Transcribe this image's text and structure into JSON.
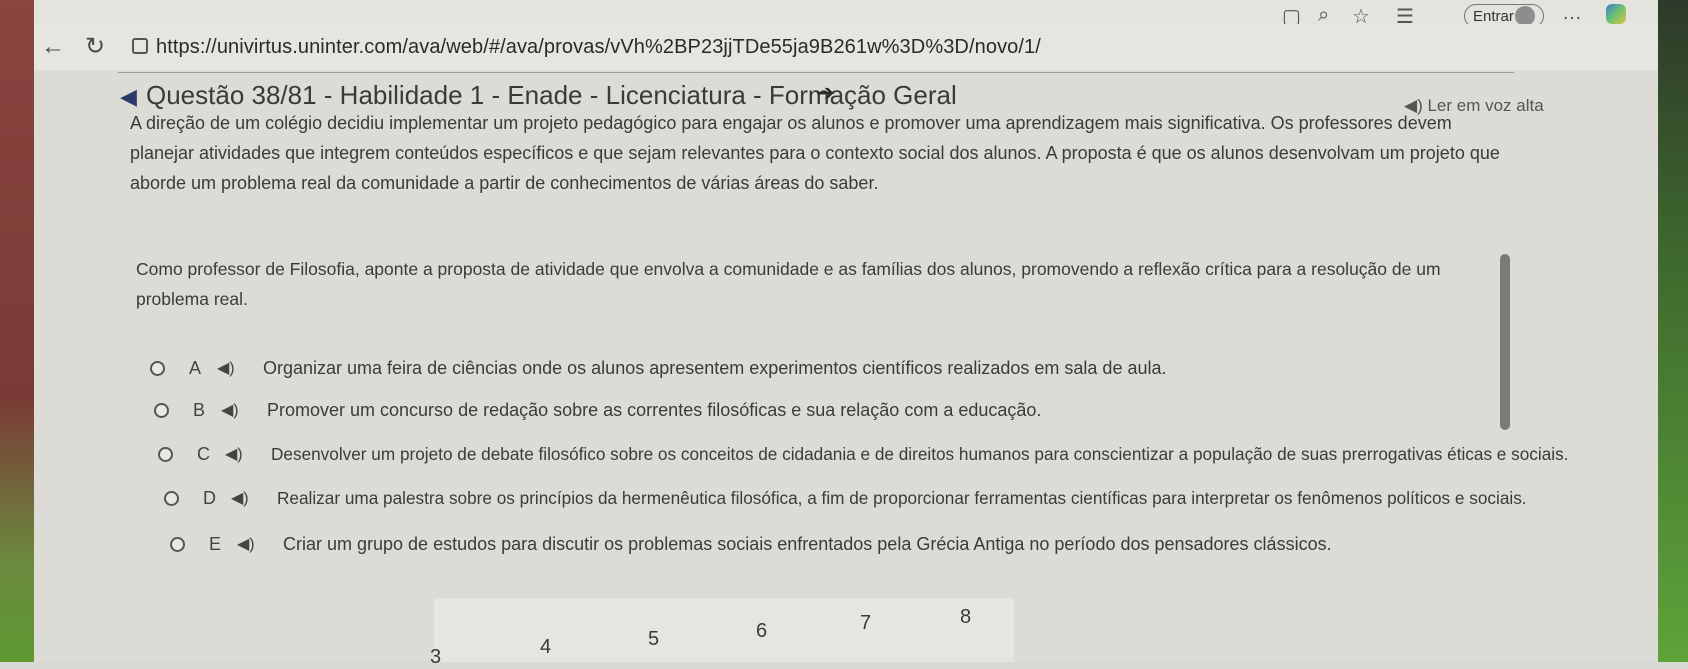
{
  "browser": {
    "url": "https://univirtus.uninter.com/ava/web/#/ava/provas/vVh%2BP23jjTDe55ja9B261w%3D%3D/novo/1/",
    "signin_label": "Entrar"
  },
  "page": {
    "title": "Questão 38/81 - Habilidade 1 - Enade - Licenciatura - Formação Geral",
    "read_aloud_label": "◀) Ler em voz alta",
    "stem_1": "A direção de um colégio decidiu implementar um projeto pedagógico para engajar os alunos e promover uma aprendizagem mais significativa. Os professores devem planejar atividades que integrem conteúdos específicos e que sejam relevantes para o contexto social dos alunos. A proposta é que os alunos desenvolvam um projeto que aborde um problema real da comunidade a partir de conhecimentos de várias áreas do saber.",
    "stem_2": "Como professor de Filosofia, aponte a proposta de atividade que envolva a comunidade e as famílias dos alunos, promovendo a reflexão crítica para a resolução de um problema real."
  },
  "options": [
    {
      "letter": "A",
      "text": "Organizar uma feira de ciências onde os alunos apresentem experimentos científicos realizados em sala de aula."
    },
    {
      "letter": "B",
      "text": "Promover um concurso de redação sobre as correntes filosóficas e sua relação com a educação."
    },
    {
      "letter": "C",
      "text": "Desenvolver um projeto de debate filosófico sobre os conceitos de cidadania e de direitos humanos para conscientizar a população de suas prerrogativas éticas e sociais."
    },
    {
      "letter": "D",
      "text": "Realizar uma palestra sobre os princípios da hermenêutica filosófica, a fim de proporcionar ferramentas científicas para interpretar os fenômenos políticos e sociais."
    },
    {
      "letter": "E",
      "text": "Criar um grupo de estudos para discutir os problemas sociais enfrentados pela Grécia Antiga no período dos pensadores clássicos."
    }
  ],
  "pager": {
    "pages": [
      "3",
      "4",
      "5",
      "6",
      "7",
      "8"
    ]
  },
  "icons": {
    "back": "arrow-left-icon",
    "reload": "reload-icon",
    "lock": "lock-icon",
    "speaker": "speaker-icon",
    "title_back": "arrow-left-icon",
    "title_forward": "arrow-right-icon"
  }
}
